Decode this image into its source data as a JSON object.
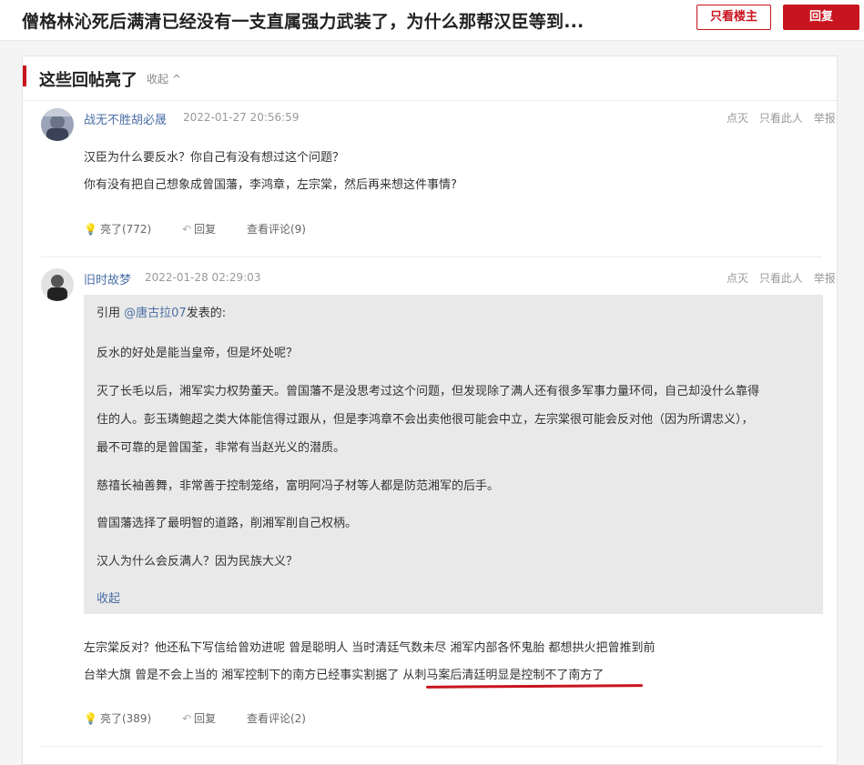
{
  "header": {
    "title": "僧格林沁死后满清已经没有一支直属强力武装了，为什么那帮汉臣等到...",
    "only_op_label": "只看楼主",
    "reply_label": "回复"
  },
  "section": {
    "title": "这些回帖亮了",
    "collapse_label": "收起 ^"
  },
  "posts": [
    {
      "username": "战无不胜胡必晟",
      "time": "2022-01-27 20:56:59",
      "actions": [
        "点灭",
        "只看此人",
        "举报"
      ],
      "lines": [
        "汉臣为什么要反水？你自己有没有想过这个问题？",
        "你有没有把自己想象成曾国藩，李鸿章，左宗棠，然后再来想这件事情?"
      ],
      "bar": {
        "light": "亮了(772)",
        "reply": "回复",
        "comments": "查看评论(9)"
      }
    },
    {
      "username": "旧时故梦",
      "time": "2022-01-28 02:29:03",
      "actions": [
        "点灭",
        "只看此人",
        "举报"
      ],
      "quote": {
        "prefix": "引用 ",
        "user": "@唐古拉07",
        "suffix": "发表的:",
        "paragraphs": [
          "反水的好处是能当皇帝，但是坏处呢？",
          "灭了长毛以后，湘军实力权势董天。曾国藩不是没思考过这个问题，但发现除了满人还有很多军事力量环伺，自己却没什么靠得",
          "住的人。彭玉璘鲍超之类大体能信得过跟从，但是李鸿章不会出卖他很可能会中立，左宗棠很可能会反对他（因为所谓忠义），",
          "最不可靠的是曾国荃，非常有当赵光义的潜质。",
          "慈禧长袖善舞，非常善于控制笼络，富明阿冯子材等人都是防范湘军的后手。",
          "曾国藩选择了最明智的道路，削湘军削自己权柄。",
          "汉人为什么会反满人？因为民族大义？"
        ],
        "collapse": "收起"
      },
      "lines": [
        "左宗棠反对？他还私下写信给曾劝进呢 曾是聪明人 当时清廷气数未尽 湘军内部各怀鬼胎 都想拱火把曾推到前",
        "台举大旗 曾是不会上当的 湘军控制下的南方已经事实割据了 从刺马案后清廷明显是控制不了南方了"
      ],
      "bar": {
        "light": "亮了(389)",
        "reply": "回复",
        "comments": "查看评论(2)"
      }
    }
  ],
  "colors": {
    "accent": "#c8141e",
    "link": "#4a6fa5"
  }
}
